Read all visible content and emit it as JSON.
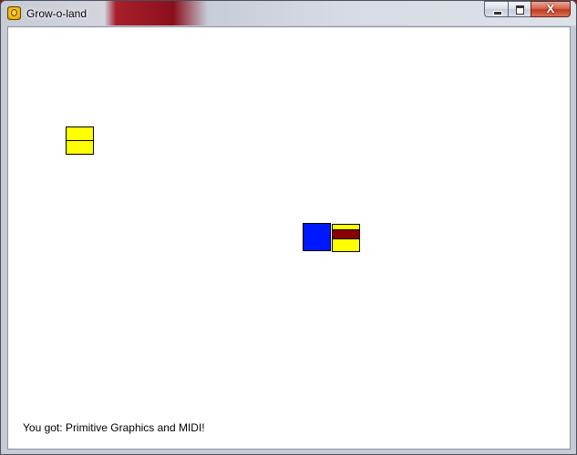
{
  "window": {
    "title": "Grow-o-land",
    "icon": "app-icon",
    "controls": [
      "minimize-icon",
      "maximize-icon",
      "close-icon"
    ],
    "close_glyph": "X"
  },
  "game": {
    "status_text": "You got: Primitive Graphics and MIDI!",
    "blocks": [
      {
        "kind": "yellow-split",
        "color": "#ffff00"
      },
      {
        "kind": "blue",
        "color": "#0018ff"
      },
      {
        "kind": "yellow-red",
        "colors": [
          "#ffff00",
          "#8b0000"
        ]
      }
    ]
  }
}
